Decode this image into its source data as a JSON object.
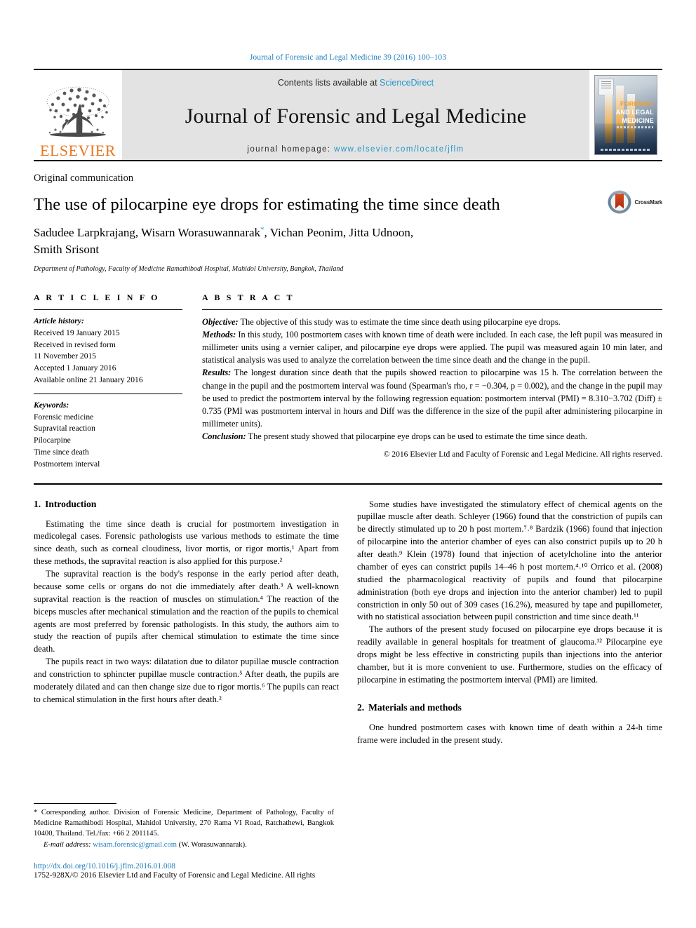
{
  "running_head": "Journal of Forensic and Legal Medicine 39 (2016) 100–103",
  "masthead": {
    "publisher_logo_word": "ELSEVIER",
    "contents_prefix": "Contents lists available at ",
    "contents_link": "ScienceDirect",
    "journal_title": "Journal of Forensic and Legal Medicine",
    "homepage_prefix": "journal homepage: ",
    "homepage_link": "www.elsevier.com/locate/jflm",
    "cover": {
      "line1": "FORENSIC",
      "line2": "AND LEGAL",
      "line3": "MEDICINE"
    },
    "colors": {
      "link_blue": "#2596c8",
      "elsevier_orange": "#E87722",
      "band_gray": "#e3e3e3"
    }
  },
  "article": {
    "communication_type": "Original communication",
    "title": "The use of pilocarpine eye drops for estimating the time since death",
    "authors": "Sadudee Larpkrajang, Wisarn Worasuwannarak*, Vichan Peonim, Jitta Udnoon, Smith Srisont",
    "authors_line1_a": "Sadudee Larpkrajang, Wisarn Worasuwannarak",
    "authors_line1_b": ", Vichan Peonim, Jitta Udnoon,",
    "authors_line2": "Smith Srisont",
    "author_marker": "*",
    "affiliation": "Department of Pathology, Faculty of Medicine Ramathibodi Hospital, Mahidol University, Bangkok, Thailand",
    "crossmark_label": "CrossMark"
  },
  "article_info": {
    "heading": "A R T I C L E   I N F O",
    "history_label": "Article history:",
    "history": [
      "Received 19 January 2015",
      "Received in revised form",
      "11 November 2015",
      "Accepted 1 January 2016",
      "Available online 21 January 2016"
    ],
    "keywords_label": "Keywords:",
    "keywords": [
      "Forensic medicine",
      "Supravital reaction",
      "Pilocarpine",
      "Time since death",
      "Postmortem interval"
    ]
  },
  "abstract": {
    "heading": "A B S T R A C T",
    "objective_label": "Objective:",
    "objective_text": " The objective of this study was to estimate the time since death using pilocarpine eye drops.",
    "methods_label": "Methods:",
    "methods_text": " In this study, 100 postmortem cases with known time of death were included. In each case, the left pupil was measured in millimeter units using a vernier caliper, and pilocarpine eye drops were applied. The pupil was measured again 10 min later, and statistical analysis was used to analyze the correlation between the time since death and the change in the pupil.",
    "results_label": "Results:",
    "results_text": " The longest duration since death that the pupils showed reaction to pilocarpine was 15 h. The correlation between the change in the pupil and the postmortem interval was found (Spearman's rho, r = −0.304, p = 0.002), and the change in the pupil may be used to predict the postmortem interval by the following regression equation: postmortem interval (PMI) = 8.310−3.702 (Diff) ± 0.735 (PMI was postmortem interval in hours and Diff was the difference in the size of the pupil after administering pilocarpine in millimeter units).",
    "conclusion_label": "Conclusion:",
    "conclusion_text": " The present study showed that pilocarpine eye drops can be used to estimate the time since death.",
    "copyright": "© 2016 Elsevier Ltd and Faculty of Forensic and Legal Medicine. All rights reserved."
  },
  "sections": {
    "introduction": {
      "number": "1.",
      "title": "Introduction",
      "paragraphs": [
        "Estimating the time since death is crucial for postmortem investigation in medicolegal cases. Forensic pathologists use various methods to estimate the time since death, such as corneal cloudiness, livor mortis, or rigor mortis,¹ Apart from these methods, the supravital reaction is also applied for this purpose.²",
        "The supravital reaction is the body's response in the early period after death, because some cells or organs do not die immediately after death.³ A well-known supravital reaction is the reaction of muscles on stimulation.⁴ The reaction of the biceps muscles after mechanical stimulation and the reaction of the pupils to chemical agents are most preferred by forensic pathologists. In this study, the authors aim to study the reaction of pupils after chemical stimulation to estimate the time since death.",
        "The pupils react in two ways: dilatation due to dilator pupillae muscle contraction and constriction to sphincter pupillae muscle contraction.⁵ After death, the pupils are moderately dilated and can then change size due to rigor mortis.⁶ The pupils can react to chemical stimulation in the first hours after death.²",
        "Some studies have investigated the stimulatory effect of chemical agents on the pupillae muscle after death. Schleyer (1966) found that the constriction of pupils can be directly stimulated up to 20 h post mortem.⁷˒⁸ Bardzik (1966) found that injection of pilocarpine into the anterior chamber of eyes can also constrict pupils up to 20 h after death.⁹ Klein (1978) found that injection of acetylcholine into the anterior chamber of eyes can constrict pupils 14–46 h post mortem.⁴˒¹⁰ Orrico et al. (2008) studied the pharmacological reactivity of pupils and found that pilocarpine administration (both eye drops and injection into the anterior chamber) led to pupil constriction in only 50 out of 309 cases (16.2%), measured by tape and pupillometer, with no statistical association between pupil constriction and time since death.¹¹",
        "The authors of the present study focused on pilocarpine eye drops because it is readily available in general hospitals for treatment of glaucoma.¹² Pilocarpine eye drops might be less effective in constricting pupils than injections into the anterior chamber, but it is more convenient to use. Furthermore, studies on the efficacy of pilocarpine in estimating the postmortem interval (PMI) are limited."
      ]
    },
    "materials": {
      "number": "2.",
      "title": "Materials and methods",
      "paragraphs": [
        "One hundred postmortem cases with known time of death within a 24-h time frame were included in the present study."
      ]
    }
  },
  "footnote": {
    "star": "*",
    "corresponding": " Corresponding author. Division of Forensic Medicine, Department of Pathology, Faculty of Medicine Ramathibodi Hospital, Mahidol University, 270 Rama VI Road, Ratchathewi, Bangkok 10400, Thailand. Tel./fax: +66 2 2011145.",
    "email_label": "E-mail address:",
    "email": "wisarn.forensic@gmail.com",
    "email_suffix": " (W. Worasuwannarak).",
    "doi": "http://dx.doi.org/10.1016/j.jflm.2016.01.008",
    "issn": "1752-928X/© 2016 Elsevier Ltd and Faculty of Forensic and Legal Medicine. All rights"
  }
}
